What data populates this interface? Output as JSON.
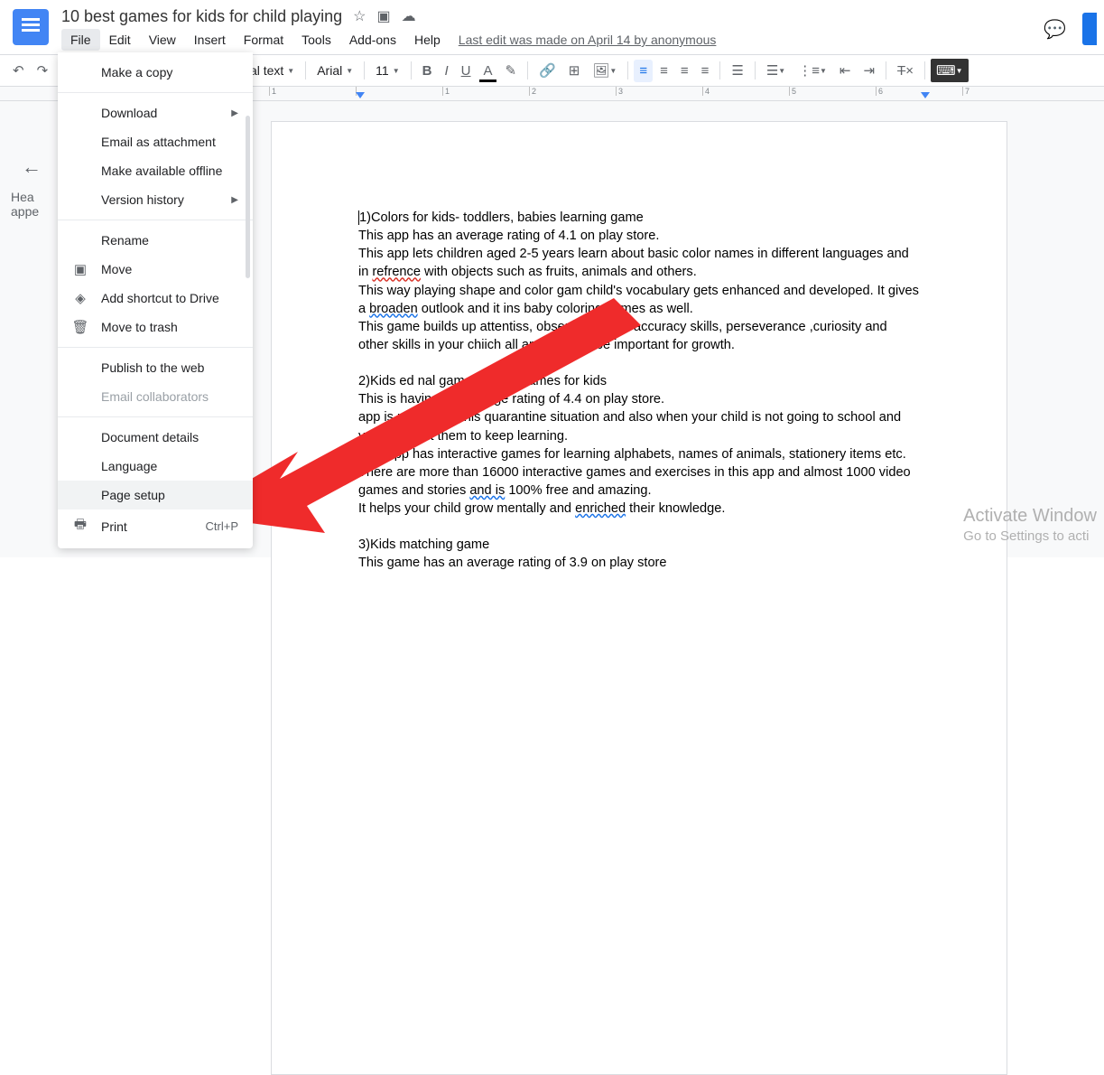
{
  "header": {
    "title": "10 best games for kids for child playing",
    "menus": [
      "File",
      "Edit",
      "View",
      "Insert",
      "Format",
      "Tools",
      "Add-ons",
      "Help"
    ],
    "last_edit": "Last edit was made on April 14 by anonymous"
  },
  "toolbar": {
    "style_select": "nal text",
    "font_select": "Arial",
    "font_size": "11"
  },
  "outline": {
    "hint1": "Hea",
    "hint2": "appe"
  },
  "file_menu": {
    "make_copy": "Make a copy",
    "download": "Download",
    "email_attachment": "Email as attachment",
    "make_offline": "Make available offline",
    "version_history": "Version history",
    "rename": "Rename",
    "move": "Move",
    "add_shortcut": "Add shortcut to Drive",
    "move_trash": "Move to trash",
    "publish_web": "Publish to the web",
    "email_collab": "Email collaborators",
    "doc_details": "Document details",
    "language": "Language",
    "page_setup": "Page setup",
    "print": "Print",
    "print_shortcut": "Ctrl+P"
  },
  "document": {
    "p1": "1)Colors for kids- toddlers, babies learning game",
    "p2": "This app has an average rating of 4.1 on play store.",
    "p3a": "This app lets children aged 2-5 years learn about basic color names in different languages and in ",
    "p3_err": "refrence",
    "p3b": " with objects such as fruits, animals and others.",
    "p4a": "This way playing shape and color gam",
    "p4b": " child's vocabulary gets enhanced and developed. It gives a ",
    "p4_err": "broaden",
    "p4c": " outlook and it in",
    "p4d": "s baby coloring games as well.",
    "p5a": "This game builds up attenti",
    "p5b": "ss, observation and accuracy skills, perseverance ,curiosity and other skills in your chi",
    "p5c": "ich all are found to be important for growth.",
    "p6": "2)Kids ed           nal game,english games for kids",
    "p7": "This        is having an average rating of 4.4 on play store.",
    "p8": "      app is perfect for this quarantine situation and also when your child is not going to school and you still want them to keep learning.",
    "p9": "This app has interactive games for learning alphabets, names of animals, stationery items etc.",
    "p10a": "There are more than 16000 interactive games and exercises in this app and almost 1000 video games and stories ",
    "p10_err": "and is",
    "p10b": " 100% free and amazing.",
    "p11a": "It helps your child grow mentally and ",
    "p11_err": "enriched",
    "p11b": " their knowledge.",
    "p12": "3)Kids matching game",
    "p13": "This game has an average rating of 3.9 on play store"
  },
  "watermark": {
    "line1": "Activate Window",
    "line2": "Go to Settings to acti"
  },
  "ruler": {
    "marks": [
      "1",
      "",
      "1",
      "2",
      "3",
      "4",
      "5",
      "6",
      "7"
    ]
  }
}
